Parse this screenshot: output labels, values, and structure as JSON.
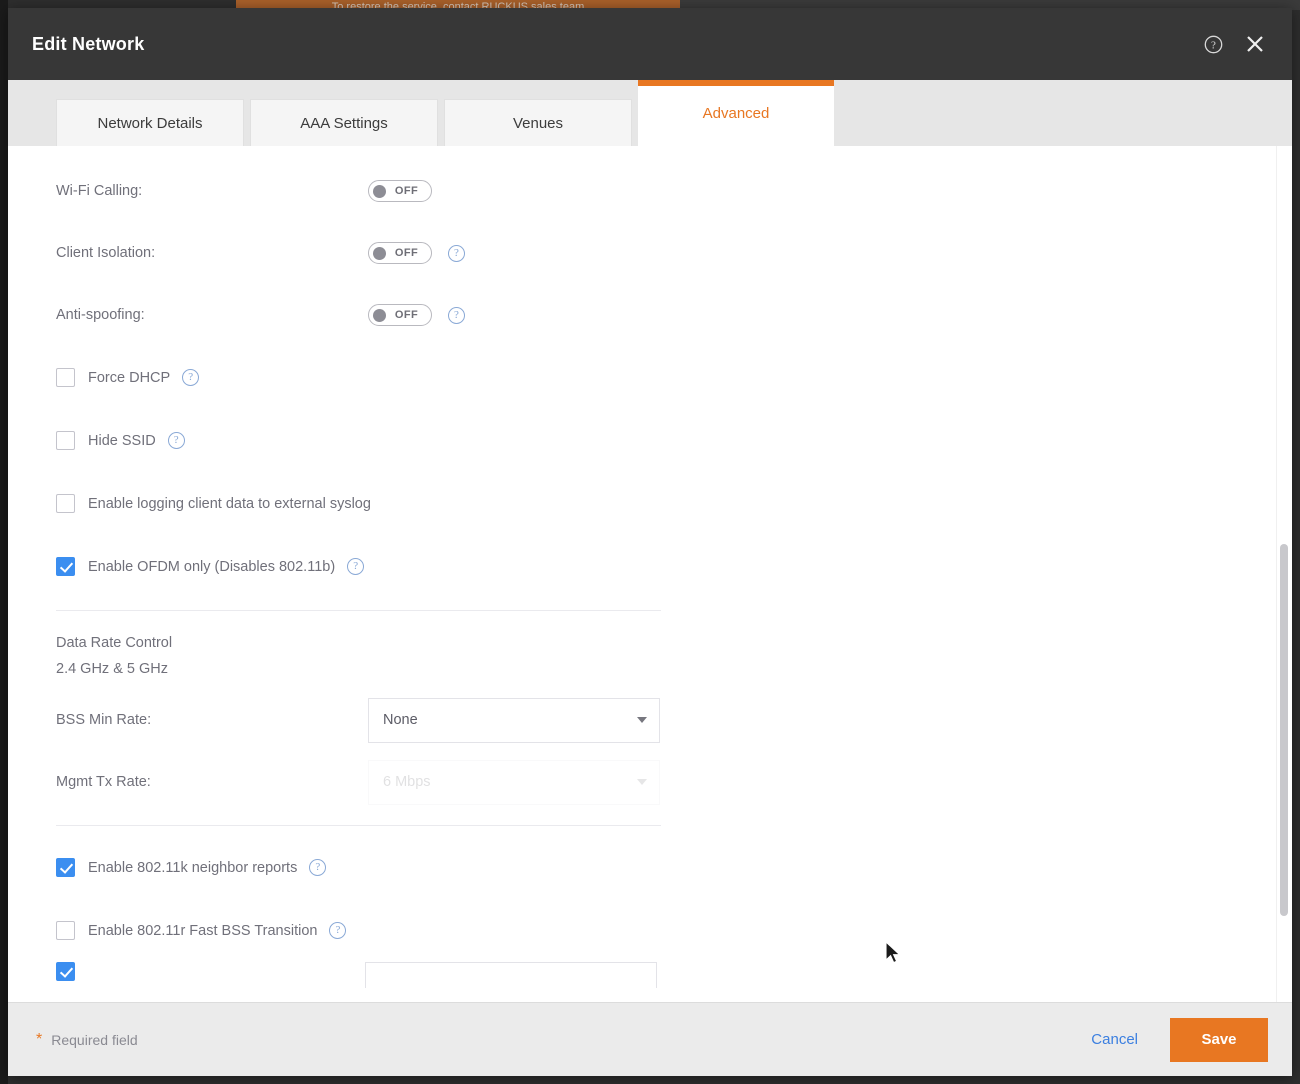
{
  "background": {
    "banner_text": "To restore the service, contact RUCKUS sales team"
  },
  "header": {
    "title": "Edit Network",
    "help_icon": "help-circle-icon",
    "close_icon": "close-icon"
  },
  "tabs": [
    {
      "label": "Network Details",
      "active": false
    },
    {
      "label": "AAA Settings",
      "active": false
    },
    {
      "label": "Venues",
      "active": false
    },
    {
      "label": "Advanced",
      "active": true
    }
  ],
  "advanced": {
    "toggles": [
      {
        "label": "Wi-Fi Calling:",
        "state": "OFF",
        "help": false
      },
      {
        "label": "Client Isolation:",
        "state": "OFF",
        "help": true
      },
      {
        "label": "Anti-spoofing:",
        "state": "OFF",
        "help": true
      }
    ],
    "checkboxes": [
      {
        "label": "Force DHCP",
        "checked": false,
        "help": true
      },
      {
        "label": "Hide SSID",
        "checked": false,
        "help": true
      },
      {
        "label": "Enable logging client data to external syslog",
        "checked": false,
        "help": false
      },
      {
        "label": "Enable OFDM only (Disables 802.11b)",
        "checked": true,
        "help": true
      }
    ],
    "data_rate_control": {
      "title": "Data Rate Control",
      "bands": "2.4 GHz & 5 GHz",
      "bss_min_rate": {
        "label": "BSS Min Rate:",
        "value": "None"
      },
      "mgmt_tx_rate": {
        "label": "Mgmt Tx Rate:",
        "value": "6 Mbps"
      }
    },
    "checkboxes_2": [
      {
        "label": "Enable 802.11k neighbor reports",
        "checked": true,
        "help": true
      },
      {
        "label": "Enable 802.11r Fast BSS Transition",
        "checked": false,
        "help": true
      }
    ]
  },
  "footer": {
    "required_marker": "*",
    "required_text": "Required field",
    "cancel_label": "Cancel",
    "save_label": "Save"
  },
  "colors": {
    "accent": "#e87722",
    "header_bg": "#373737",
    "checkbox_checked": "#3b8ef0",
    "link": "#3b7fe0",
    "label_text": "#70707a"
  }
}
